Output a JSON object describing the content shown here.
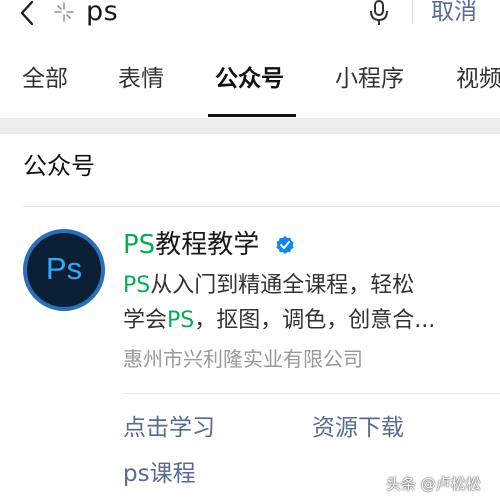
{
  "search_bar": {
    "query": "ps",
    "cancel_label": "取消",
    "icons": [
      "back-icon",
      "sparkle-icon",
      "mic-icon"
    ]
  },
  "tabs": [
    {
      "label": "全部",
      "active": false
    },
    {
      "label": "表情",
      "active": false
    },
    {
      "label": "公众号",
      "active": true
    },
    {
      "label": "小程序",
      "active": false
    },
    {
      "label": "视频",
      "active": false
    }
  ],
  "section": {
    "title": "公众号"
  },
  "account": {
    "logo_text": "Ps",
    "name_highlight": "PS",
    "name_rest": "教程教学",
    "verified": true,
    "desc_line1_highlight": "PS",
    "desc_line1_rest": "从入门到精通全课程，轻松",
    "desc_line2_prefix": "学会",
    "desc_line2_highlight": "PS",
    "desc_line2_rest": "，抠图，调色，创意合...",
    "company": "惠州市兴利隆实业有限公司",
    "menu": [
      "点击学习",
      "资源下载",
      "ps课程"
    ]
  },
  "watermark": "头条 @卢松松",
  "colors": {
    "highlight_green": "#06ae56",
    "link_blue": "#576b95",
    "verified_blue": "#1485ee",
    "ps_logo_bg": "#0b1f34",
    "ps_logo_text": "#35a8f5"
  }
}
